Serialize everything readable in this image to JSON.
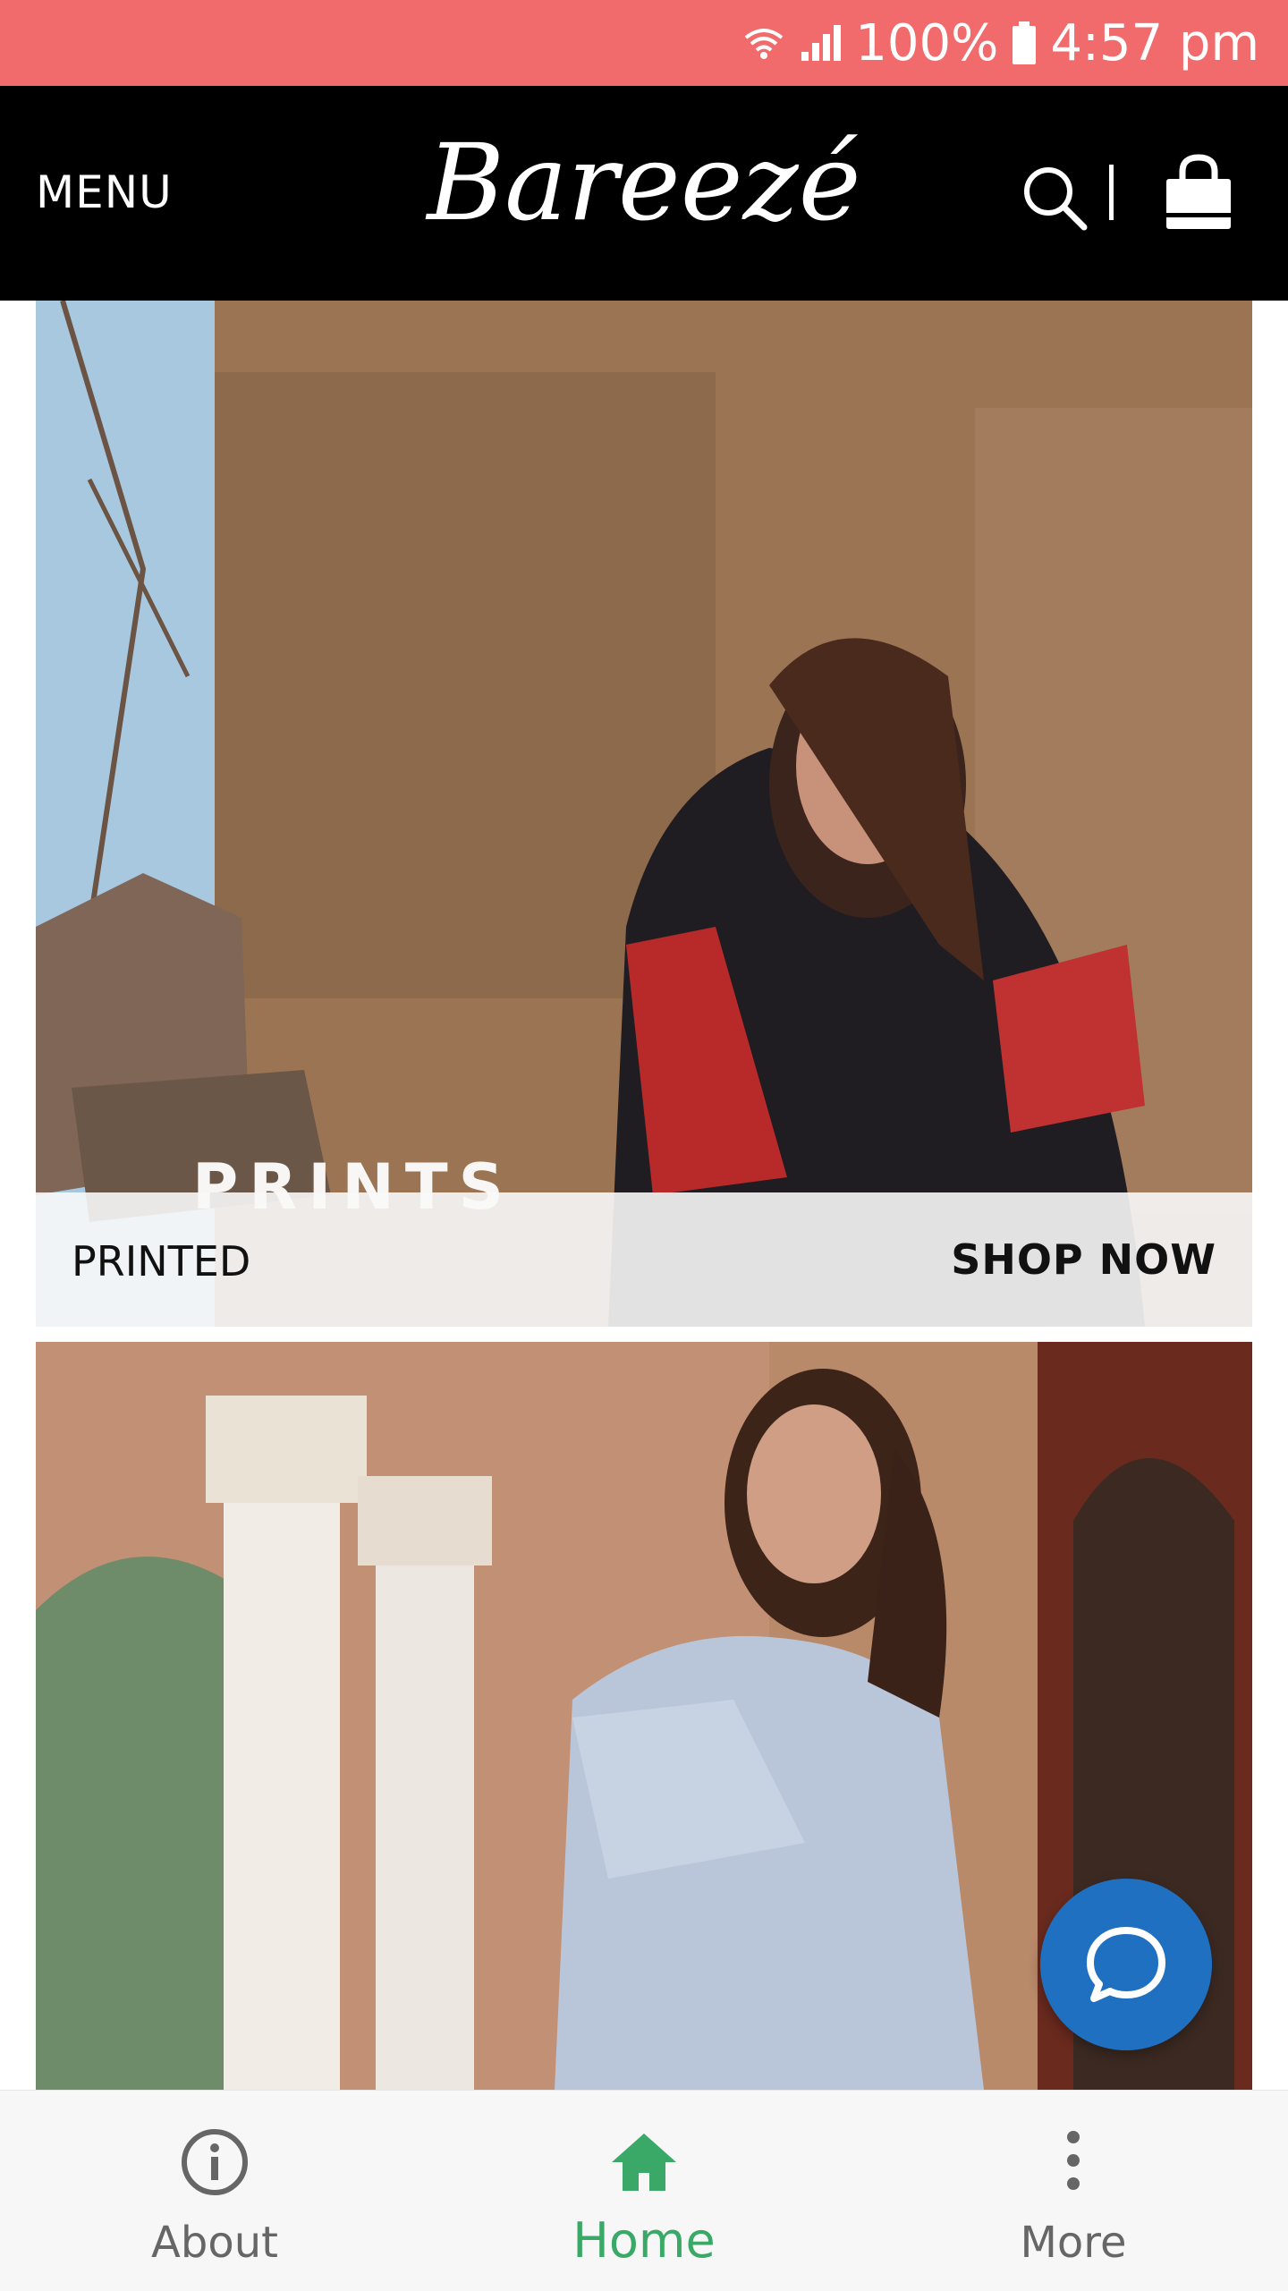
{
  "status_bar": {
    "battery": "100%",
    "time": "4:57 pm",
    "icons": [
      "wifi-icon",
      "signal-icon",
      "battery-icon"
    ]
  },
  "header": {
    "menu_label": "MENU",
    "brand": "Bareezé",
    "icons": [
      "search-icon",
      "shopping-bag-icon"
    ]
  },
  "banners": [
    {
      "overlay_text": "PRINTS",
      "category": "PRINTED",
      "cta": "SHOP NOW"
    },
    {
      "overlay_text": "",
      "category": "",
      "cta": ""
    }
  ],
  "chat": {
    "icon": "chat-bubble-icon"
  },
  "bottom_nav": {
    "items": [
      {
        "label": "About",
        "icon": "info-icon",
        "active": false
      },
      {
        "label": "Home",
        "icon": "home-icon",
        "active": true
      },
      {
        "label": "More",
        "icon": "more-vertical-icon",
        "active": false
      }
    ]
  },
  "colors": {
    "status_bar": "#f26b6c",
    "header": "#000000",
    "active_tab": "#3aa866",
    "chat_button": "#1f70c1"
  }
}
